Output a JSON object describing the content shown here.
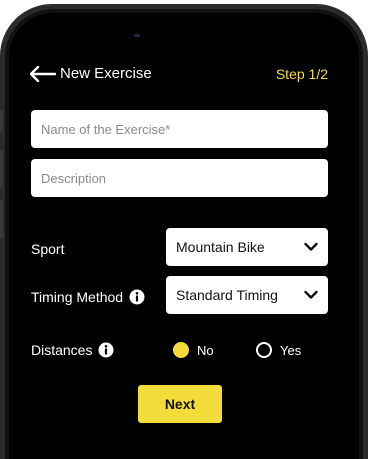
{
  "header": {
    "title": "New Exercise",
    "step": "Step 1/2"
  },
  "form": {
    "name_placeholder": "Name of the Exercise*",
    "description_placeholder": "Description",
    "sport": {
      "label": "Sport",
      "value": "Mountain Bike"
    },
    "timing_method": {
      "label": "Timing Method",
      "value": "Standard Timing"
    },
    "distances": {
      "label": "Distances",
      "options": [
        {
          "label": "No",
          "selected": true
        },
        {
          "label": "Yes",
          "selected": false
        }
      ]
    }
  },
  "actions": {
    "next_label": "Next"
  },
  "colors": {
    "accent": "#f4dd3a",
    "screen_background": "#000000",
    "field_background": "#ffffff"
  },
  "icons": {
    "back": "arrow-left-icon",
    "info": "info-icon",
    "dropdown": "chevron-down-icon"
  }
}
